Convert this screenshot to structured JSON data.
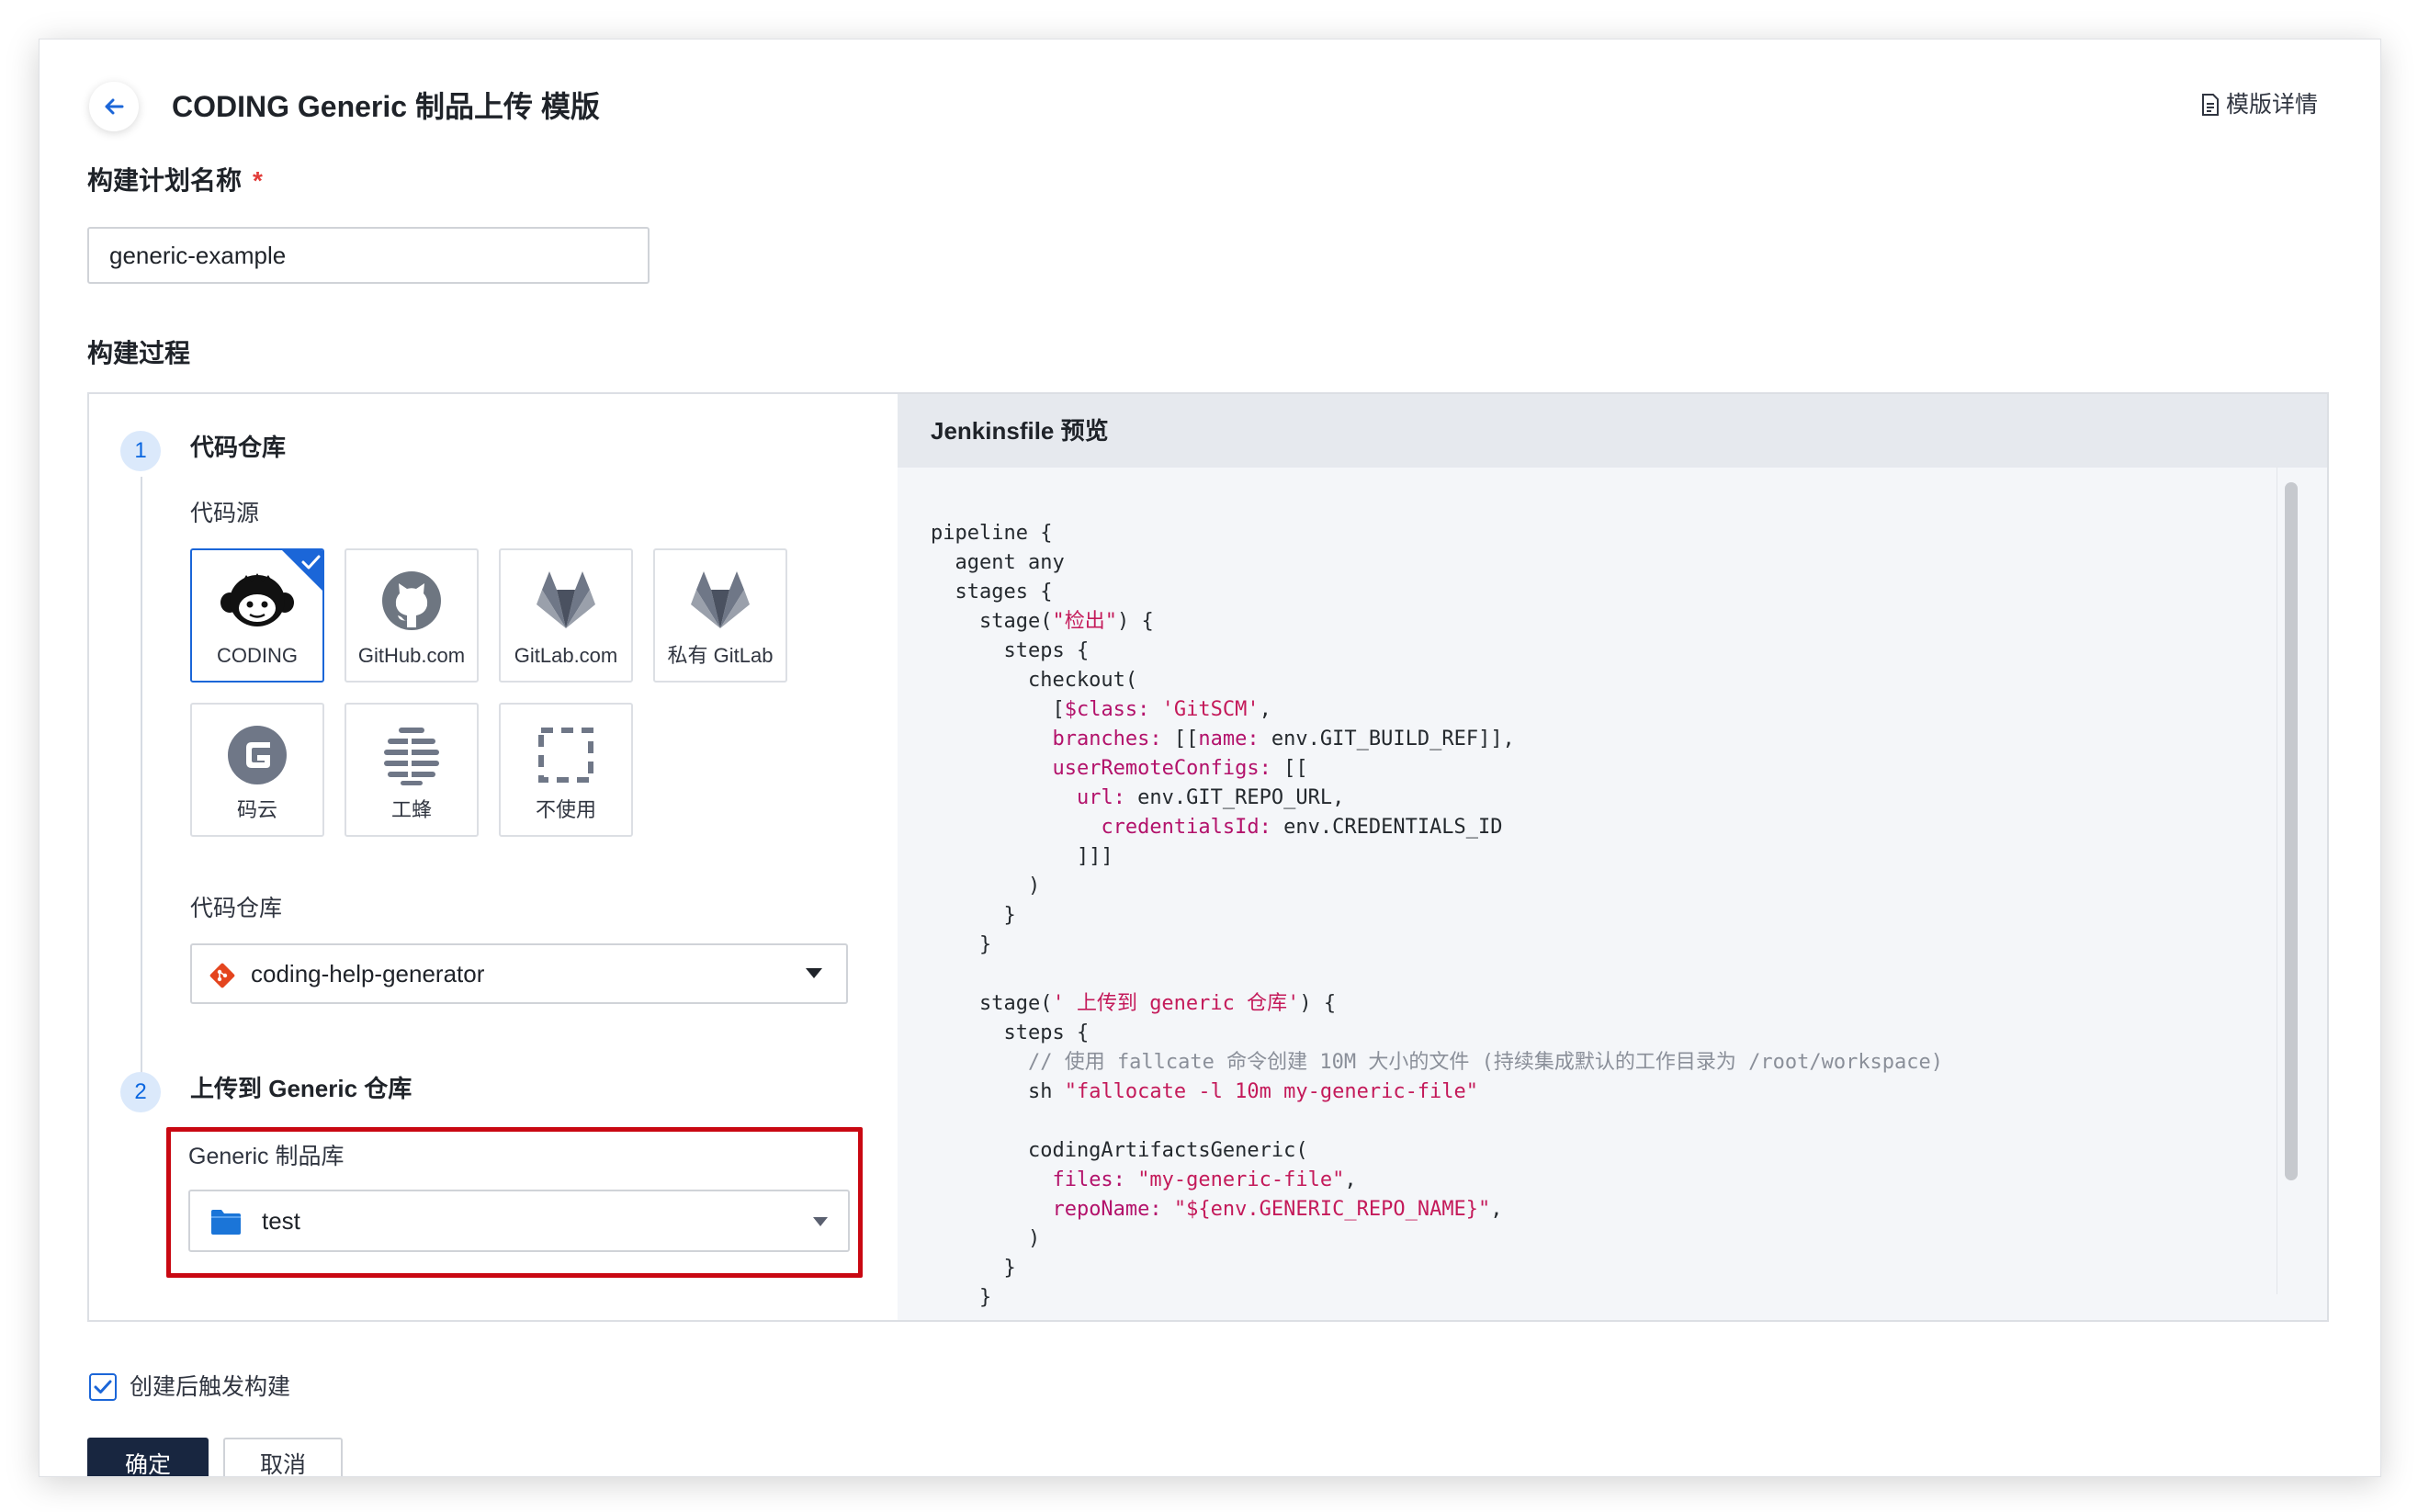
{
  "header": {
    "title": "CODING Generic 制品上传 模版",
    "template_link": "模版详情"
  },
  "form": {
    "plan_name_label": "构建计划名称",
    "required_mark": "*",
    "plan_name_value": "generic-example",
    "process_label": "构建过程"
  },
  "steps": [
    {
      "number": "1",
      "title": "代码仓库",
      "source_label": "代码源",
      "sources": [
        {
          "label": "CODING",
          "icon": "coding-monkey-icon",
          "selected": true
        },
        {
          "label": "GitHub.com",
          "icon": "github-icon",
          "selected": false
        },
        {
          "label": "GitLab.com",
          "icon": "gitlab-icon",
          "selected": false
        },
        {
          "label": "私有 GitLab",
          "icon": "gitlab-icon",
          "selected": false
        },
        {
          "label": "码云",
          "icon": "gitee-icon",
          "selected": false
        },
        {
          "label": "工蜂",
          "icon": "tgit-icon",
          "selected": false
        },
        {
          "label": "不使用",
          "icon": "dashed-square-icon",
          "selected": false
        }
      ],
      "repo_label": "代码仓库",
      "repo_value": "coding-help-generator"
    },
    {
      "number": "2",
      "title": "上传到 Generic 仓库",
      "artifact_label": "Generic 制品库",
      "artifact_value": "test"
    }
  ],
  "preview": {
    "title": "Jenkinsfile 预览",
    "code_lines": [
      [
        {
          "t": "pipeline {",
          "c": "#24292e"
        }
      ],
      [
        {
          "t": "  agent any",
          "c": "#24292e"
        }
      ],
      [
        {
          "t": "  stages {",
          "c": "#24292e"
        }
      ],
      [
        {
          "t": "    stage(",
          "c": "#24292e"
        },
        {
          "t": "\"检出\"",
          "c": "#c41a5a"
        },
        {
          "t": ") {",
          "c": "#24292e"
        }
      ],
      [
        {
          "t": "      steps {",
          "c": "#24292e"
        }
      ],
      [
        {
          "t": "        checkout(",
          "c": "#24292e"
        }
      ],
      [
        {
          "t": "          [",
          "c": "#24292e"
        },
        {
          "t": "$class:",
          "c": "#b3126b"
        },
        {
          "t": " ",
          "c": "#24292e"
        },
        {
          "t": "'GitSCM'",
          "c": "#c41a5a"
        },
        {
          "t": ",",
          "c": "#24292e"
        }
      ],
      [
        {
          "t": "          ",
          "c": "#24292e"
        },
        {
          "t": "branches:",
          "c": "#b3126b"
        },
        {
          "t": " [[",
          "c": "#24292e"
        },
        {
          "t": "name:",
          "c": "#b3126b"
        },
        {
          "t": " env.GIT_BUILD_REF]],",
          "c": "#24292e"
        }
      ],
      [
        {
          "t": "          ",
          "c": "#24292e"
        },
        {
          "t": "userRemoteConfigs:",
          "c": "#b3126b"
        },
        {
          "t": " [[",
          "c": "#24292e"
        }
      ],
      [
        {
          "t": "            ",
          "c": "#24292e"
        },
        {
          "t": "url:",
          "c": "#b3126b"
        },
        {
          "t": " env.GIT_REPO_URL,",
          "c": "#24292e"
        }
      ],
      [
        {
          "t": "              ",
          "c": "#24292e"
        },
        {
          "t": "credentialsId:",
          "c": "#b3126b"
        },
        {
          "t": " env.CREDENTIALS_ID",
          "c": "#24292e"
        }
      ],
      [
        {
          "t": "            ]]]",
          "c": "#24292e"
        }
      ],
      [
        {
          "t": "        )",
          "c": "#24292e"
        }
      ],
      [
        {
          "t": "      }",
          "c": "#24292e"
        }
      ],
      [
        {
          "t": "    }",
          "c": "#24292e"
        }
      ],
      [
        {
          "t": "",
          "c": "#24292e"
        }
      ],
      [
        {
          "t": "    stage(",
          "c": "#24292e"
        },
        {
          "t": "' 上传到 generic 仓库'",
          "c": "#c41a5a"
        },
        {
          "t": ") {",
          "c": "#24292e"
        }
      ],
      [
        {
          "t": "      steps {",
          "c": "#24292e"
        }
      ],
      [
        {
          "t": "        // 使用 fallcate 命令创建 10M 大小的文件 (持续集成默认的工作目录为 /root/workspace)",
          "c": "#8a8f99"
        }
      ],
      [
        {
          "t": "        sh ",
          "c": "#24292e"
        },
        {
          "t": "\"fallocate -l 10m my-generic-file\"",
          "c": "#c41a5a"
        }
      ],
      [
        {
          "t": "",
          "c": "#24292e"
        }
      ],
      [
        {
          "t": "        codingArtifactsGeneric(",
          "c": "#24292e"
        }
      ],
      [
        {
          "t": "          ",
          "c": "#24292e"
        },
        {
          "t": "files:",
          "c": "#b3126b"
        },
        {
          "t": " ",
          "c": "#24292e"
        },
        {
          "t": "\"my-generic-file\"",
          "c": "#c41a5a"
        },
        {
          "t": ",",
          "c": "#24292e"
        }
      ],
      [
        {
          "t": "          ",
          "c": "#24292e"
        },
        {
          "t": "repoName:",
          "c": "#b3126b"
        },
        {
          "t": " ",
          "c": "#24292e"
        },
        {
          "t": "\"${env.GENERIC_REPO_NAME}\"",
          "c": "#c41a5a"
        },
        {
          "t": ",",
          "c": "#24292e"
        }
      ],
      [
        {
          "t": "        )",
          "c": "#24292e"
        }
      ],
      [
        {
          "t": "      }",
          "c": "#24292e"
        }
      ],
      [
        {
          "t": "    }",
          "c": "#24292e"
        }
      ]
    ]
  },
  "footer": {
    "trigger_label": "创建后触发构建",
    "trigger_checked": true,
    "confirm_label": "确定",
    "cancel_label": "取消"
  },
  "colors": {
    "accent": "#1b66d8",
    "highlight": "#c90812",
    "primary_button": "#182640",
    "required": "#e23c39"
  }
}
